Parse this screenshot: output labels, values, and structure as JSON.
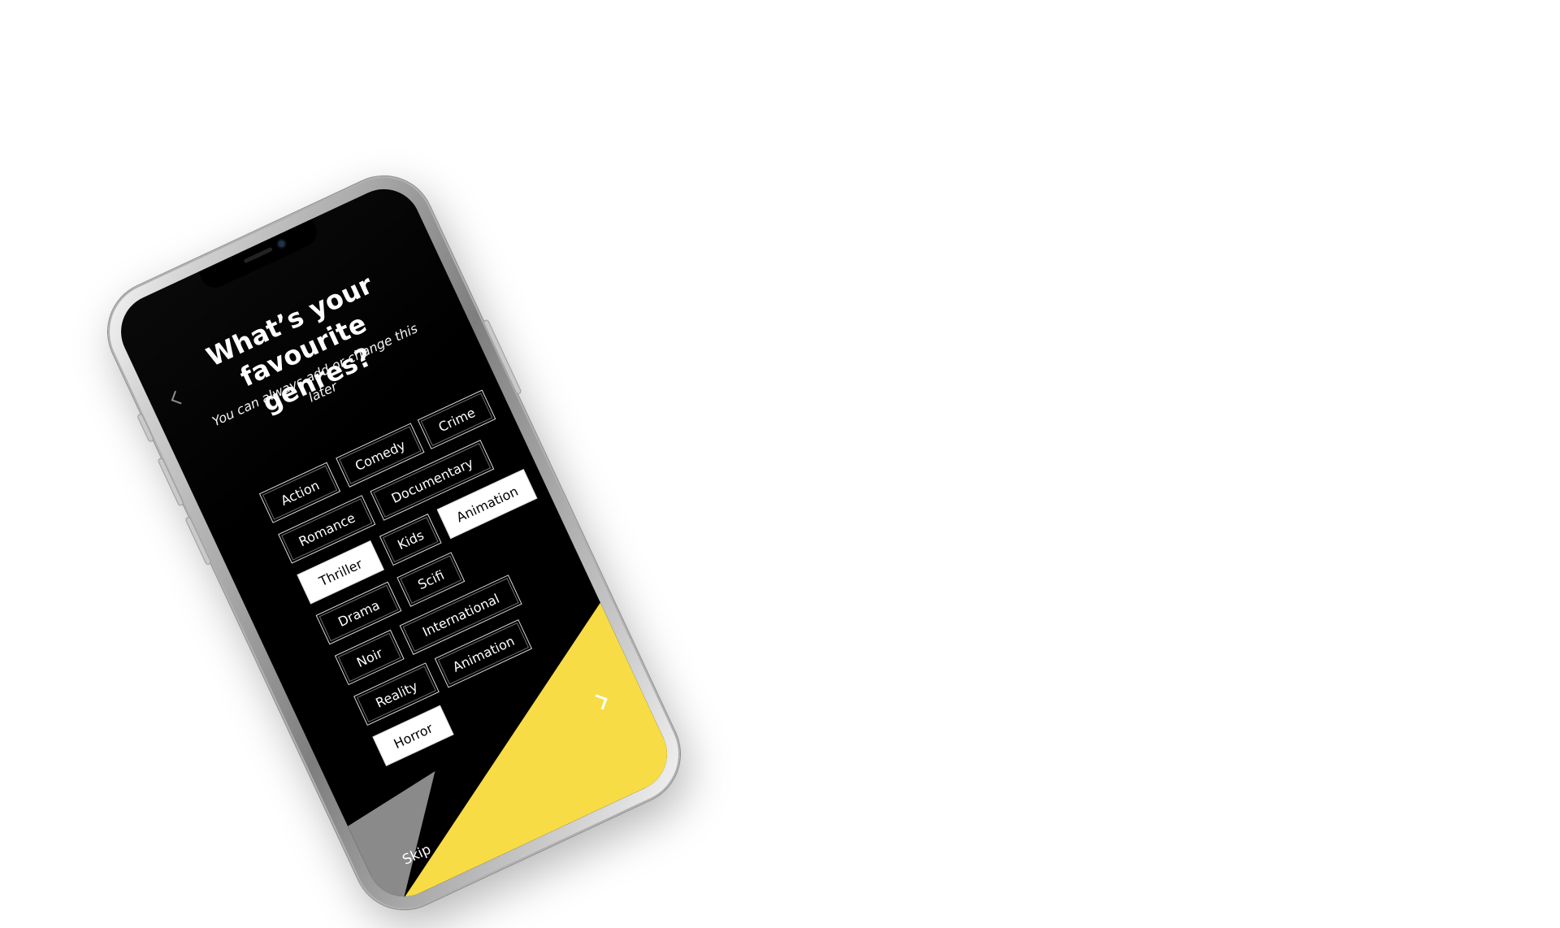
{
  "screen": {
    "title": "What’s your favourite genres?",
    "subtitle": "You can always add or change this later",
    "back_icon": "chevron-left-icon",
    "next_icon": "chevron-right-icon",
    "skip_label": "Skip"
  },
  "genres": [
    {
      "label": "Action",
      "selected": false
    },
    {
      "label": "Comedy",
      "selected": false
    },
    {
      "label": "Crime",
      "selected": false
    },
    {
      "label": "Romance",
      "selected": false
    },
    {
      "label": "Documentary",
      "selected": false
    },
    {
      "label": "Thriller",
      "selected": true
    },
    {
      "label": "Kids",
      "selected": false
    },
    {
      "label": "Animation",
      "selected": true
    },
    {
      "label": "Drama",
      "selected": false
    },
    {
      "label": "Scifi",
      "selected": false
    },
    {
      "label": "Noir",
      "selected": false
    },
    {
      "label": "International",
      "selected": false
    },
    {
      "label": "Reality",
      "selected": false
    },
    {
      "label": "Animation",
      "selected": false
    },
    {
      "label": "Horror",
      "selected": true
    }
  ],
  "colors": {
    "screen_background": "#000000",
    "text": "#ffffff",
    "selected_chip": "#ffffff",
    "accent_yellow": "#f7dc46",
    "skip_area": "#8b8a8b"
  }
}
